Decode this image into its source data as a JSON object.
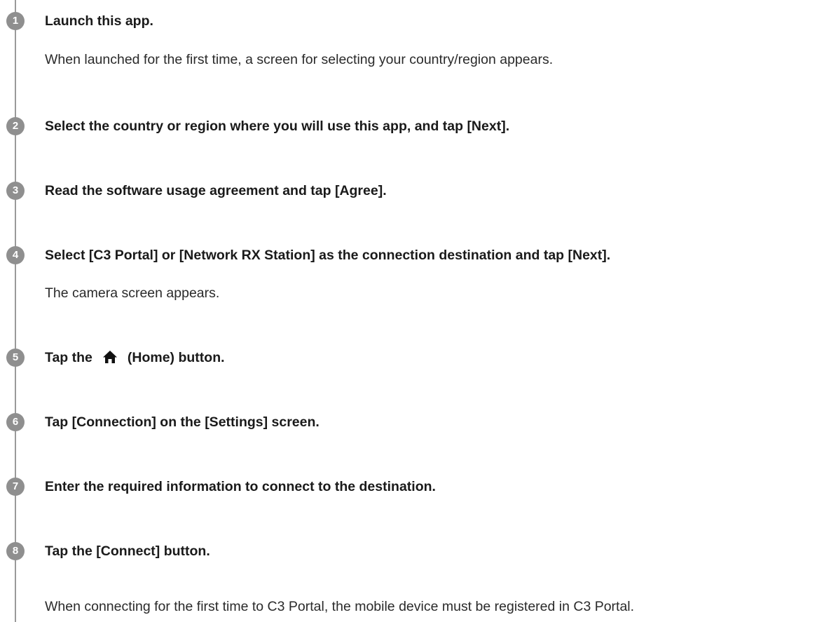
{
  "steps": [
    {
      "number": "1",
      "title": "Launch this app.",
      "description": "When launched for the first time, a screen for selecting your country/region appears."
    },
    {
      "number": "2",
      "title": "Select the country or region where you will use this app, and tap [Next]."
    },
    {
      "number": "3",
      "title": "Read the software usage agreement and tap [Agree]."
    },
    {
      "number": "4",
      "title": "Select [C3 Portal] or [Network RX Station] as the connection destination and tap [Next].",
      "description": "The camera screen appears."
    },
    {
      "number": "5",
      "title_before": "Tap the",
      "title_icon": "home-icon",
      "title_after": "(Home) button."
    },
    {
      "number": "6",
      "title": "Tap [Connection] on the [Settings] screen."
    },
    {
      "number": "7",
      "title": "Enter the required information to connect to the destination."
    },
    {
      "number": "8",
      "title": "Tap the [Connect] button.",
      "description": "When connecting for the first time to C3 Portal, the mobile device must be registered in C3 Portal."
    }
  ],
  "colors": {
    "badge": "#8f8f8f",
    "rail": "#9a9a9a",
    "text": "#1a1a1a"
  }
}
